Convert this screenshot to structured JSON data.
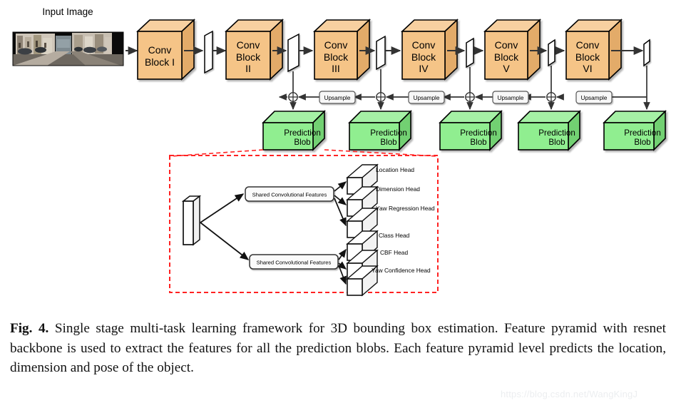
{
  "figure": {
    "input_label": "Input Image",
    "backbone": {
      "conv_blocks": [
        {
          "id": "conv-block-i",
          "line1": "Conv",
          "line2": "Block I",
          "line3": ""
        },
        {
          "id": "conv-block-ii",
          "line1": "Conv",
          "line2": "Block",
          "line3": "II"
        },
        {
          "id": "conv-block-iii",
          "line1": "Conv",
          "line2": "Block",
          "line3": "III"
        },
        {
          "id": "conv-block-iv",
          "line1": "Conv",
          "line2": "Block",
          "line3": "IV"
        },
        {
          "id": "conv-block-v",
          "line1": "Conv",
          "line2": "Block",
          "line3": "V"
        },
        {
          "id": "conv-block-vi",
          "line1": "Conv",
          "line2": "Block",
          "line3": "VI"
        }
      ],
      "upsample_label": "Upsample",
      "upsample_count": 4,
      "merge_symbol": "⊕",
      "prediction_blobs": [
        {
          "line1": "Prediction",
          "line2": "Blob"
        },
        {
          "line1": "Prediction",
          "line2": "Blob"
        },
        {
          "line1": "Prediction",
          "line2": "Blob"
        },
        {
          "line1": "Prediction",
          "line2": "Blob"
        },
        {
          "line1": "Prediction",
          "line2": "Blob"
        }
      ]
    },
    "head_inset": {
      "shared_branch_top_label": "Shared Convolutional Features",
      "shared_branch_bottom_label": "Shared Convolutional Features",
      "heads_top": [
        "Location Head",
        "Dimension Head",
        "Yaw Regression Head"
      ],
      "heads_bottom": [
        "Class Head",
        "CBF  Head",
        "Yaw Confidence Head"
      ]
    },
    "colors": {
      "conv_block_fill": "#f5c487",
      "conv_block_top": "#f7d0a0",
      "conv_block_side": "#e3ab69",
      "prediction_fill": "#90ee90",
      "prediction_top": "#a5f1a5",
      "prediction_side": "#72d072",
      "outline": "#000000",
      "inset_border": "#ff2222",
      "arrow": "#333333",
      "watermark": "#eceef0"
    }
  },
  "caption": {
    "figure_number": "Fig. 4.",
    "text": " Single stage multi-task learning framework for 3D bounding box estimation. Feature pyramid with resnet backbone is used to extract the features for all the prediction blobs. Each feature pyramid level predicts the location, dimension and pose of the object."
  },
  "watermark": {
    "url": "https://blog.csdn.net/WangKingJ"
  }
}
